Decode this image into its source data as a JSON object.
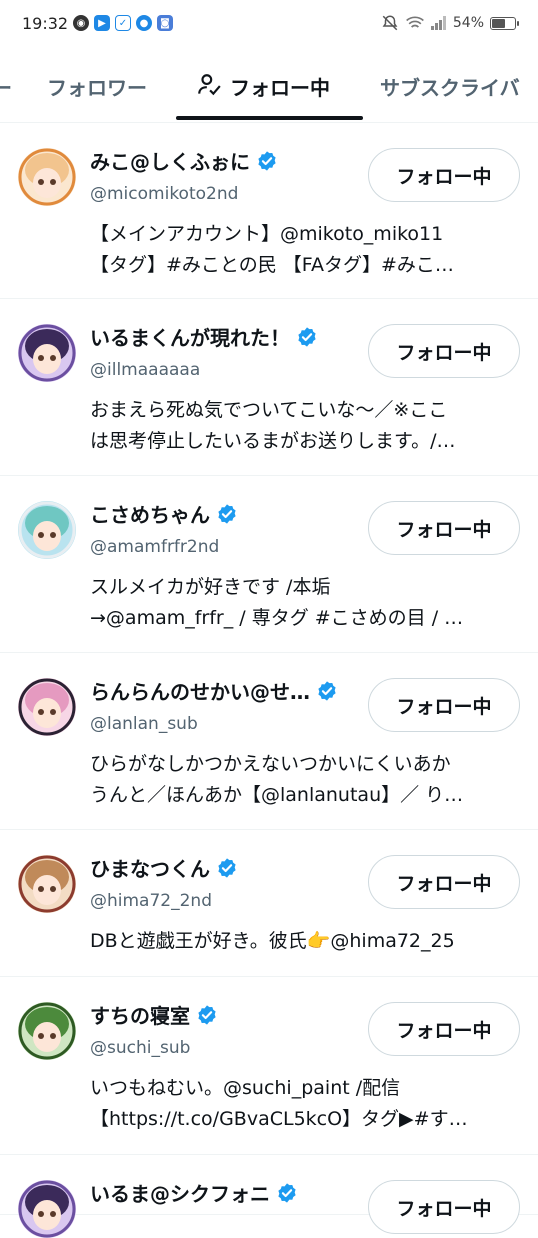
{
  "status_bar": {
    "time": "19:32",
    "battery": "54%",
    "battery_level": 0.54
  },
  "tabs": [
    {
      "label": "ー"
    },
    {
      "label": "フォロワー"
    },
    {
      "label": "フォロー中"
    },
    {
      "label": "サブスクライバ"
    }
  ],
  "users": [
    {
      "name": "みこ@しくふぉに",
      "handle": "@micomikoto2nd",
      "bio": [
        "【メインアカウント】@mikoto_miko11",
        "【タグ】#みことの民 【FAタグ】#みこ…"
      ],
      "button": "フォロー中",
      "avatar_colors": [
        "#f2c48e",
        "#e08a3c",
        "#fbe7cf"
      ]
    },
    {
      "name": "いるまくんが現れた！",
      "handle": "@illmaaaaaa",
      "bio": [
        "おまえら死ぬ気でついてこいな〜／※ここ",
        "は思考停止したいるまがお送りします。/…"
      ],
      "button": "フォロー中",
      "avatar_colors": [
        "#3b2a5a",
        "#6b4fa0",
        "#d9c7f0"
      ]
    },
    {
      "name": "こさめちゃん",
      "handle": "@amamfrfr2nd",
      "bio": [
        "スルメイカが好きです /本垢",
        "→@amam_frfr_ / 専タグ #こさめの目 / …"
      ],
      "button": "フォロー中",
      "avatar_colors": [
        "#6fc7c2",
        "#e8eef2",
        "#b9e3ef"
      ]
    },
    {
      "name": "らんらんのせかい@せ…",
      "handle": "@lanlan_sub",
      "bio": [
        "ひらがなしかつかえないつかいにくいあか",
        "うんと／ほんあか【@lanlanutau】／ り…"
      ],
      "button": "フォロー中",
      "avatar_colors": [
        "#e59ac0",
        "#2b2233",
        "#f7d6e6"
      ]
    },
    {
      "name": "ひまなつくん",
      "handle": "@hima72_2nd",
      "bio": [
        "DBと遊戯王が好き。彼氏👉@hima72_25"
      ],
      "button": "フォロー中",
      "avatar_colors": [
        "#c08a5a",
        "#8c3b2e",
        "#f3dcc4"
      ]
    },
    {
      "name": "すちの寝室",
      "handle": "@suchi_sub",
      "bio": [
        "いつもねむい。@suchi_paint /配信",
        "【https://t.co/GBvaCL5kcO】タグ▶#す…"
      ],
      "button": "フォロー中",
      "avatar_colors": [
        "#4c8a3c",
        "#2e5a23",
        "#cfe6c2"
      ]
    },
    {
      "name": "いるま@シクフォニ",
      "handle": "",
      "bio": [],
      "button": "フォロー中",
      "avatar_colors": [
        "#3b2a5a",
        "#6b4fa0",
        "#d9c7f0"
      ]
    }
  ]
}
